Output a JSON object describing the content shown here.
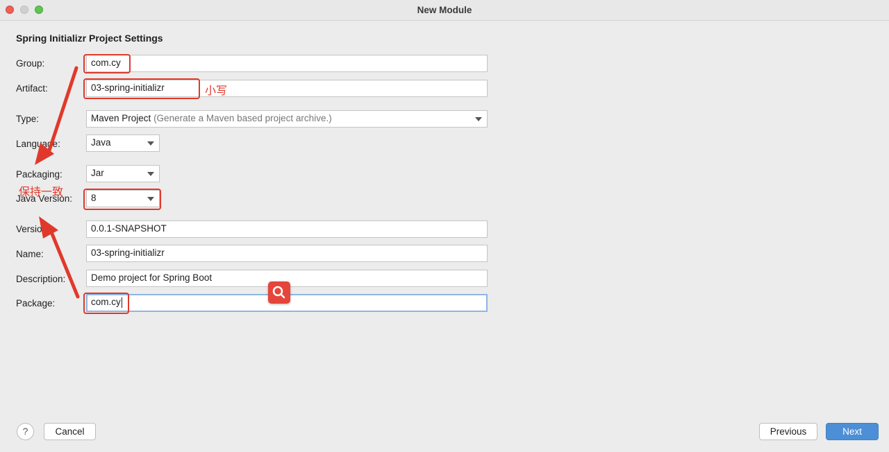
{
  "window": {
    "title": "New Module"
  },
  "section_title": "Spring Initializr Project Settings",
  "fields": {
    "group": {
      "label": "Group:",
      "value": "com.cy"
    },
    "artifact": {
      "label": "Artifact:",
      "value": "03-spring-initializr"
    },
    "type": {
      "label": "Type:",
      "value": "Maven Project",
      "hint": "(Generate a Maven based project archive.)"
    },
    "language": {
      "label": "Language:",
      "value": "Java"
    },
    "packaging": {
      "label": "Packaging:",
      "value": "Jar"
    },
    "java_version": {
      "label": "Java Version:",
      "value": "8"
    },
    "version": {
      "label": "Version:",
      "value": "0.0.1-SNAPSHOT"
    },
    "name": {
      "label": "Name:",
      "value": "03-spring-initializr"
    },
    "description": {
      "label": "Description:",
      "value": "Demo project for Spring Boot"
    },
    "package": {
      "label": "Package:",
      "value": "com.cy"
    }
  },
  "annotations": {
    "lowercase_note": "小写",
    "consistent_note": "保持一致",
    "color": "#e0392b"
  },
  "footer": {
    "help_label": "?",
    "cancel_label": "Cancel",
    "previous_label": "Previous",
    "next_label": "Next"
  },
  "icons": {
    "search_badge": "search-icon",
    "help": "help-icon"
  },
  "colors": {
    "primary_button": "#4d8fd6",
    "focus_border": "#8db5e6",
    "annotation_red": "#e0392b"
  }
}
